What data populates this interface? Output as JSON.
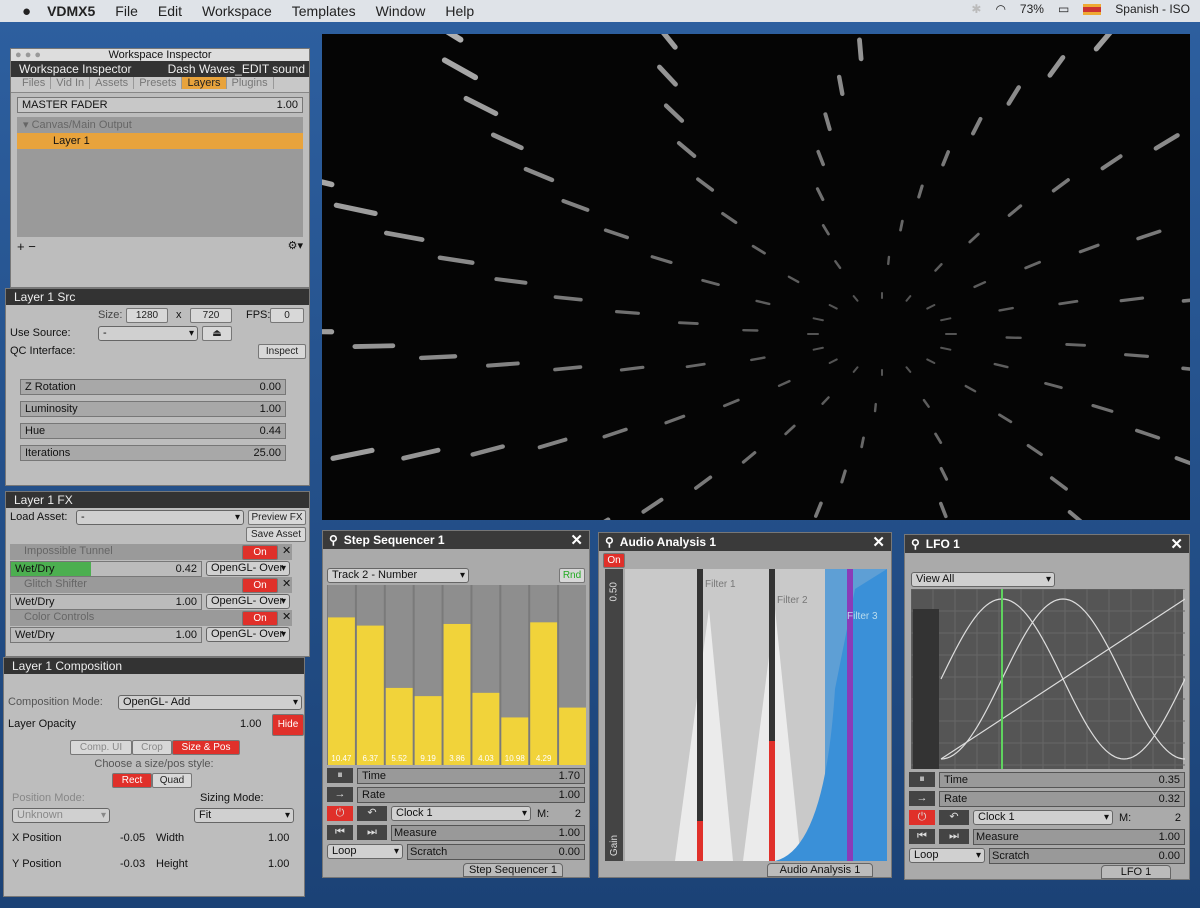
{
  "menubar": {
    "app": "VDMX5",
    "items": [
      "File",
      "Edit",
      "Workspace",
      "Templates",
      "Window",
      "Help"
    ],
    "battery": "73%",
    "language": "Spanish - ISO"
  },
  "inspector": {
    "window_title": "Workspace Inspector",
    "title": "Workspace Inspector",
    "file": "Dash Waves_EDIT sound",
    "tabs": [
      "Files",
      "Vid In",
      "Assets",
      "Presets",
      "Layers",
      "Plugins"
    ],
    "active_tab": "Layers",
    "master_fader": {
      "label": "MASTER FADER",
      "value": "1.00"
    },
    "tree": {
      "canvas": "Canvas/Main Output",
      "layer": "Layer 1"
    }
  },
  "layer_src": {
    "title": "Layer 1 Src",
    "size_label": "Size:",
    "width": "1280",
    "x": "x",
    "height": "720",
    "fps_label": "FPS:",
    "fps": "0",
    "use_source_label": "Use Source:",
    "use_source": "-",
    "qc_label": "QC Interface:",
    "inspect": "Inspect",
    "params": [
      {
        "label": "Z Rotation",
        "value": "0.00"
      },
      {
        "label": "Luminosity",
        "value": "1.00"
      },
      {
        "label": "Hue",
        "value": "0.44"
      },
      {
        "label": "Iterations",
        "value": "25.00"
      }
    ]
  },
  "layer_fx": {
    "title": "Layer 1 FX",
    "load_asset": "Load Asset:",
    "load_value": "-",
    "preview": "Preview FX",
    "save": "Save Asset",
    "effects": [
      {
        "name": "Impossible Tunnel",
        "on": "On",
        "wet": "Wet/Dry",
        "value": "0.42",
        "blend": "OpenGL- Over",
        "fill": 0.42
      },
      {
        "name": "Glitch Shifter",
        "on": "On",
        "wet": "Wet/Dry",
        "value": "1.00",
        "blend": "OpenGL- Over",
        "fill": 0
      },
      {
        "name": "Color Controls",
        "on": "On",
        "wet": "Wet/Dry",
        "value": "1.00",
        "blend": "OpenGL- Over",
        "fill": 0
      }
    ]
  },
  "layer_comp": {
    "title": "Layer 1 Composition",
    "mode_label": "Composition Mode:",
    "mode": "OpenGL- Add",
    "opacity_label": "Layer Opacity",
    "opacity": "1.00",
    "hide": "Hide",
    "tabs": [
      "Comp. UI",
      "Crop",
      "Size & Pos"
    ],
    "style_label": "Choose a size/pos style:",
    "styles": [
      "Rect",
      "Quad"
    ],
    "pos_mode": "Position Mode:",
    "pos_value": "Unknown",
    "sizing_mode": "Sizing Mode:",
    "sizing_value": "Fit",
    "xpos": {
      "label": "X Position",
      "value": "-0.05"
    },
    "ypos": {
      "label": "Y Position",
      "value": "-0.03"
    },
    "width": {
      "label": "Width",
      "value": "1.00"
    },
    "height": {
      "label": "Height",
      "value": "1.00"
    }
  },
  "step_seq": {
    "title": "Step Sequencer 1",
    "track": "Track 2 - Number",
    "rnd": "Rnd",
    "steps": [
      0.9,
      0.85,
      0.47,
      0.42,
      0.86,
      0.44,
      0.29,
      0.87,
      0.35
    ],
    "labels": [
      "10.47",
      "6.37",
      "5.52",
      "9.19",
      "3.86",
      "4.03",
      "10.98",
      "4.29"
    ],
    "time": {
      "label": "Time",
      "value": "1.70"
    },
    "rate": {
      "label": "Rate",
      "value": "1.00"
    },
    "clock": "Clock 1",
    "m": "M:",
    "mval": "2",
    "measure": {
      "label": "Measure",
      "value": "1.00"
    },
    "loop": "Loop",
    "scratch": {
      "label": "Scratch",
      "value": "0.00"
    },
    "footer": "Step Sequencer 1"
  },
  "audio": {
    "title": "Audio Analysis 1",
    "on": "On",
    "gain_top": "0.50",
    "gain": "Gain",
    "filters": [
      "Filter 1",
      "Filter 2",
      "Filter 3"
    ],
    "footer": "Audio Analysis 1"
  },
  "lfo": {
    "title": "LFO 1",
    "view": "View All",
    "time": {
      "label": "Time",
      "value": "0.35"
    },
    "rate": {
      "label": "Rate",
      "value": "0.32"
    },
    "clock": "Clock 1",
    "m": "M:",
    "mval": "2",
    "measure": {
      "label": "Measure",
      "value": "1.00"
    },
    "loop": "Loop",
    "scratch": {
      "label": "Scratch",
      "value": "0.00"
    },
    "footer": "LFO 1"
  },
  "colors": {
    "accent": "#e8a33c",
    "on": "#e0302a",
    "yellow": "#f1d33a",
    "blue": "#3a90d8",
    "green": "#5fd35f"
  }
}
